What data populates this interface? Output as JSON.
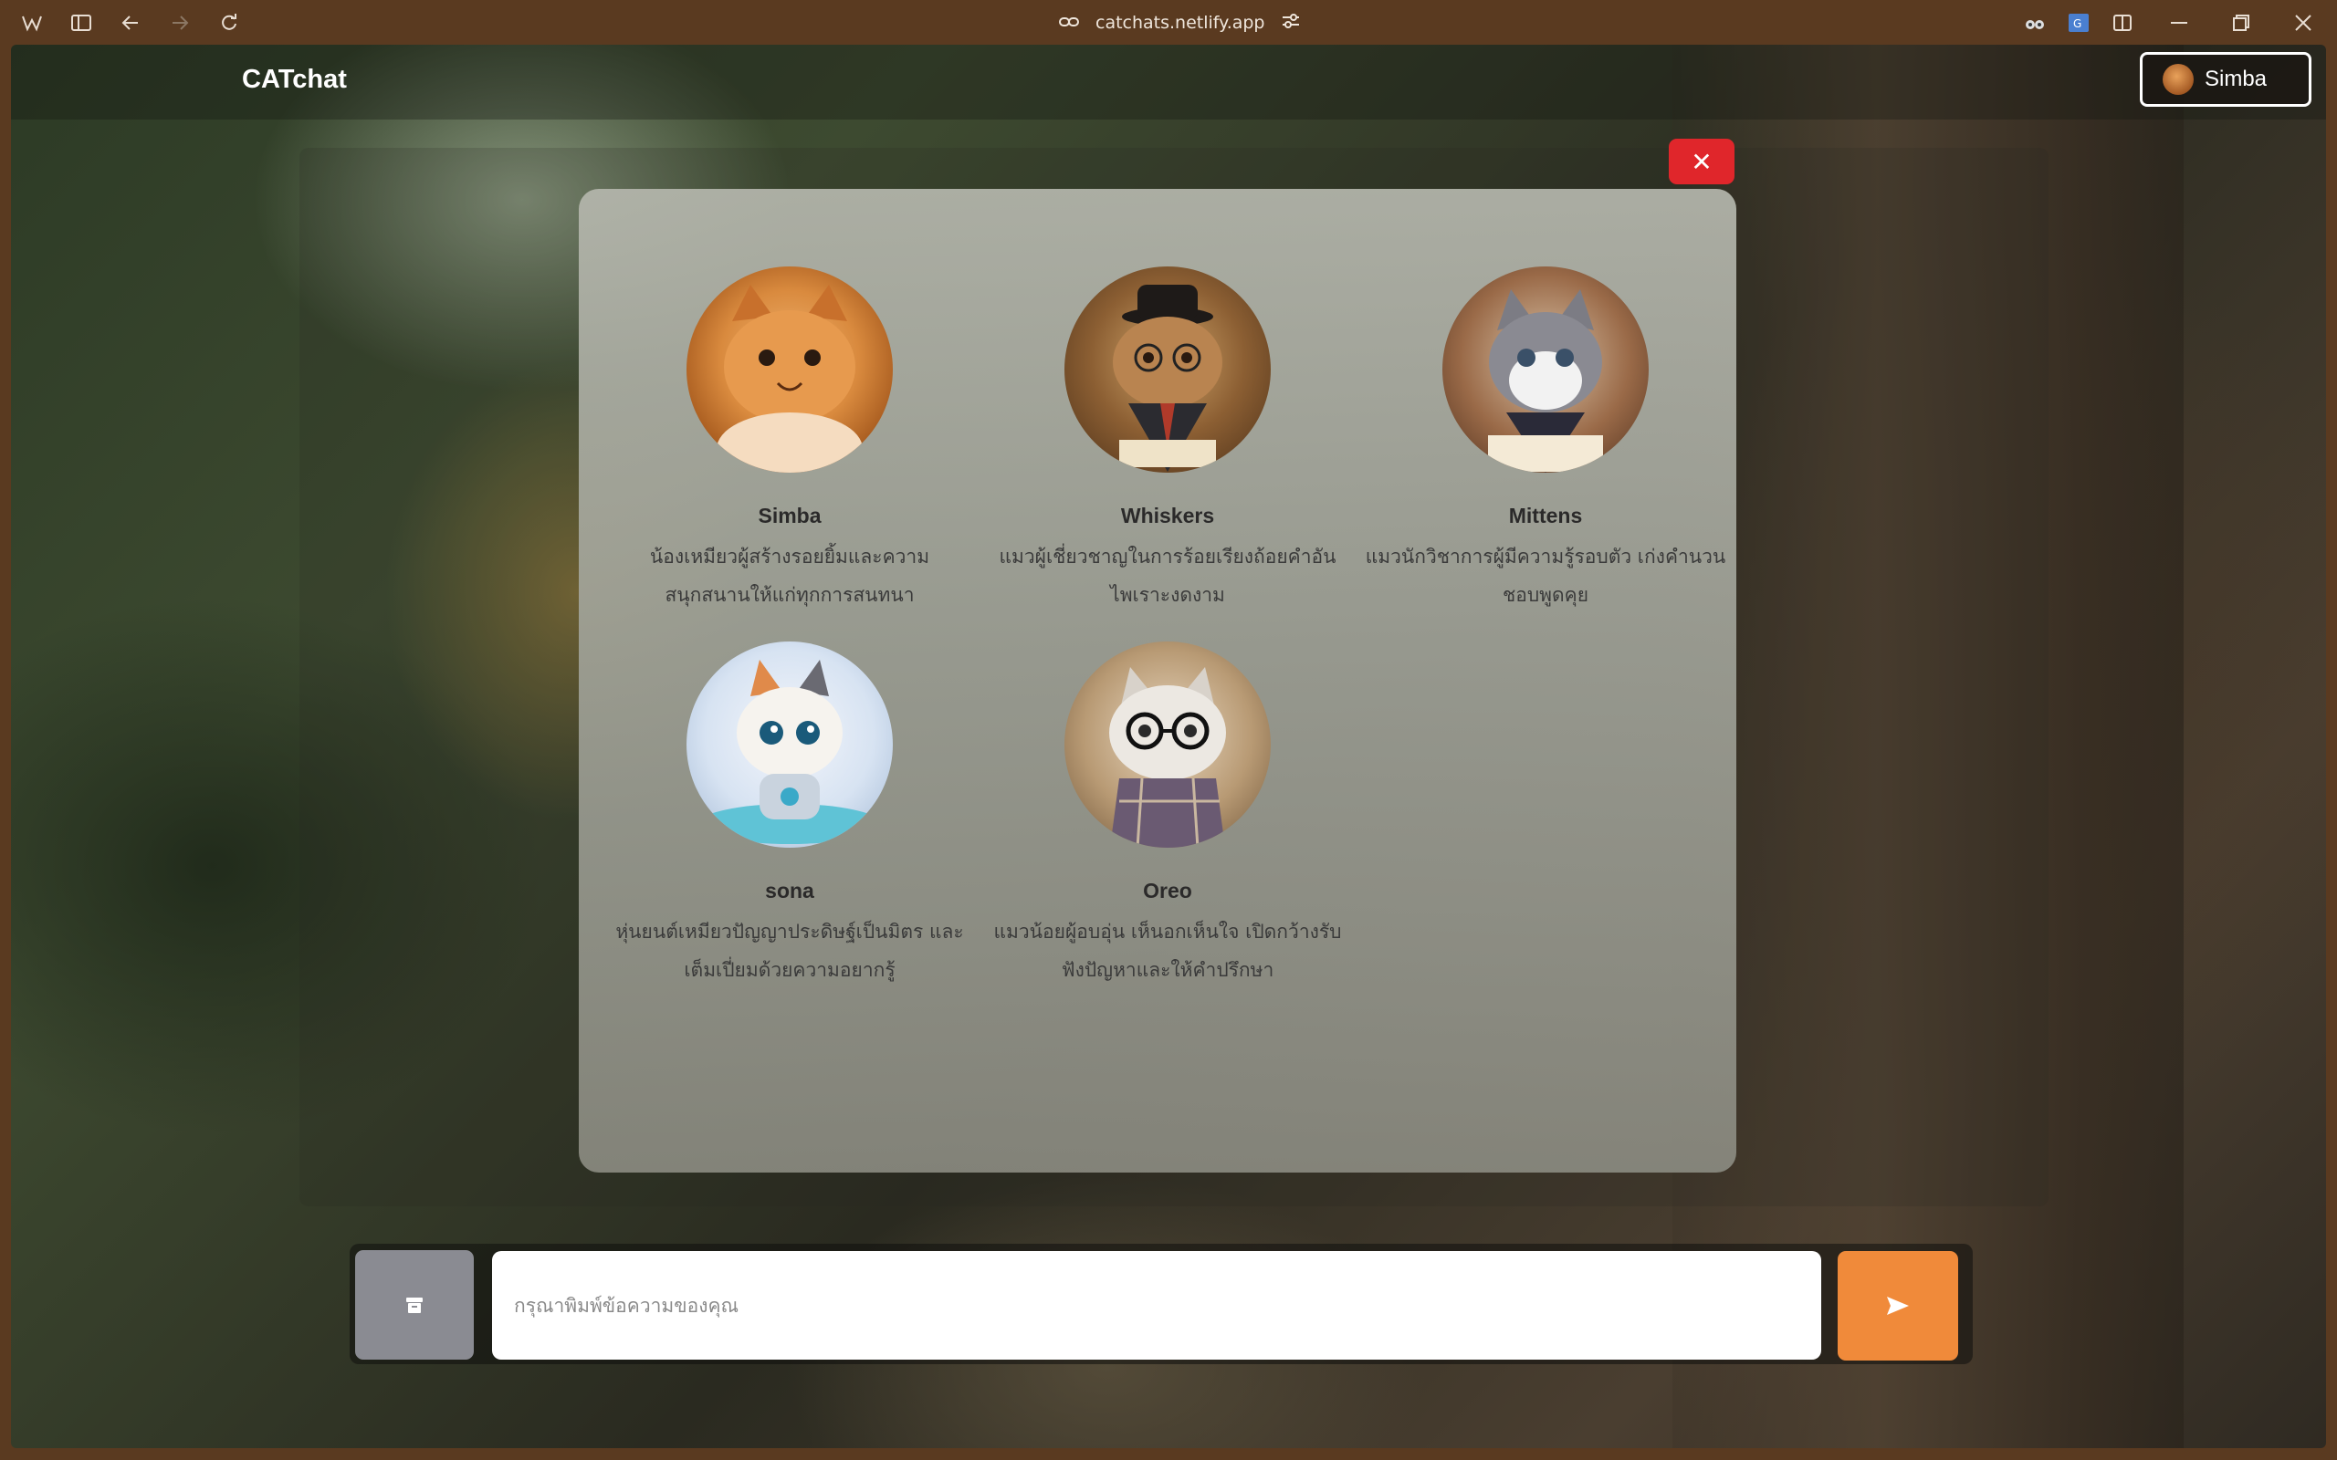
{
  "browser": {
    "url": "catchats.netlify.app"
  },
  "navbar": {
    "brand": "CATchat",
    "user_name": "Simba"
  },
  "modal": {
    "close_label": "✕",
    "cats": [
      {
        "name": "Simba",
        "desc_line1": "น้องเหมียวผู้สร้างรอยยิ้มและความ",
        "desc_line2": "สนุกสนานให้แก่ทุกการสนทนา"
      },
      {
        "name": "Whiskers",
        "desc_line1": "แมวผู้เชี่ยวชาญในการร้อยเรียงถ้อยคำอัน",
        "desc_line2": "ไพเราะงดงาม"
      },
      {
        "name": "Mittens",
        "desc_line1": "แมวนักวิชาการผู้มีความรู้รอบตัว เก่งคำนวน",
        "desc_line2": "ชอบพูดคุย"
      },
      {
        "name": "sona",
        "desc_line1": "หุ่นยนต์เหมียวปัญญาประดิษฐ์เป็นมิตร และ",
        "desc_line2": "เต็มเปี่ยมด้วยความอยากรู้"
      },
      {
        "name": "Oreo",
        "desc_line1": "แมวน้อยผู้อบอุ่น เห็นอกเห็นใจ เปิดกว้างรับ",
        "desc_line2": "ฟังปัญหาและให้คำปรึกษา"
      }
    ]
  },
  "composer": {
    "placeholder": "กรุณาพิมพ์ข้อความของคุณ",
    "archive_icon": "archive-icon",
    "send_icon": "send-icon"
  },
  "colors": {
    "close_button": "#e0262b",
    "send_button": "#f08a3a",
    "archive_button": "#8a8b92"
  }
}
